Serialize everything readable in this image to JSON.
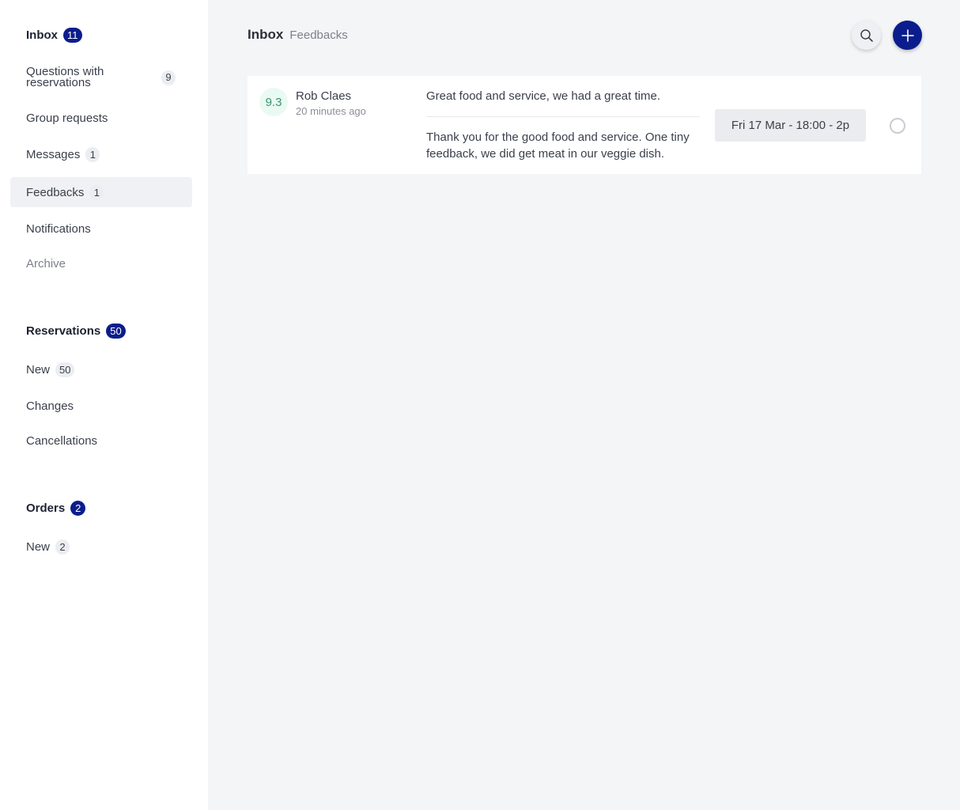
{
  "sidebar": {
    "inbox": {
      "label": "Inbox",
      "count": "11",
      "items": [
        {
          "label": "Questions with reservations",
          "count": "9"
        },
        {
          "label": "Group requests"
        },
        {
          "label": "Messages",
          "count": "1"
        },
        {
          "label": "Feedbacks",
          "count": "1",
          "active": true
        },
        {
          "label": "Notifications"
        },
        {
          "label": "Archive"
        }
      ]
    },
    "reservations": {
      "label": "Reservations",
      "count": "50",
      "items": [
        {
          "label": "New",
          "count": "50"
        },
        {
          "label": "Changes"
        },
        {
          "label": "Cancellations"
        }
      ]
    },
    "orders": {
      "label": "Orders",
      "count": "2",
      "items": [
        {
          "label": "New",
          "count": "2"
        }
      ]
    }
  },
  "header": {
    "title": "Inbox",
    "subtitle": "Feedbacks",
    "search_icon": "search-icon",
    "add_icon": "plus-icon"
  },
  "feedback": {
    "score": "9.3",
    "name": "Rob Claes",
    "time": "20 minutes ago",
    "title": "Great food and service, we had a great time.",
    "body": "Thank you for the good food and service. One tiny feedback, we did get meat in our veggie dish.",
    "reservation": "Fri 17 Mar - 18:00 - 2p"
  },
  "colors": {
    "accent": "#0b1d8c",
    "background": "#f4f5f7",
    "score_bg": "#e9faf3"
  }
}
